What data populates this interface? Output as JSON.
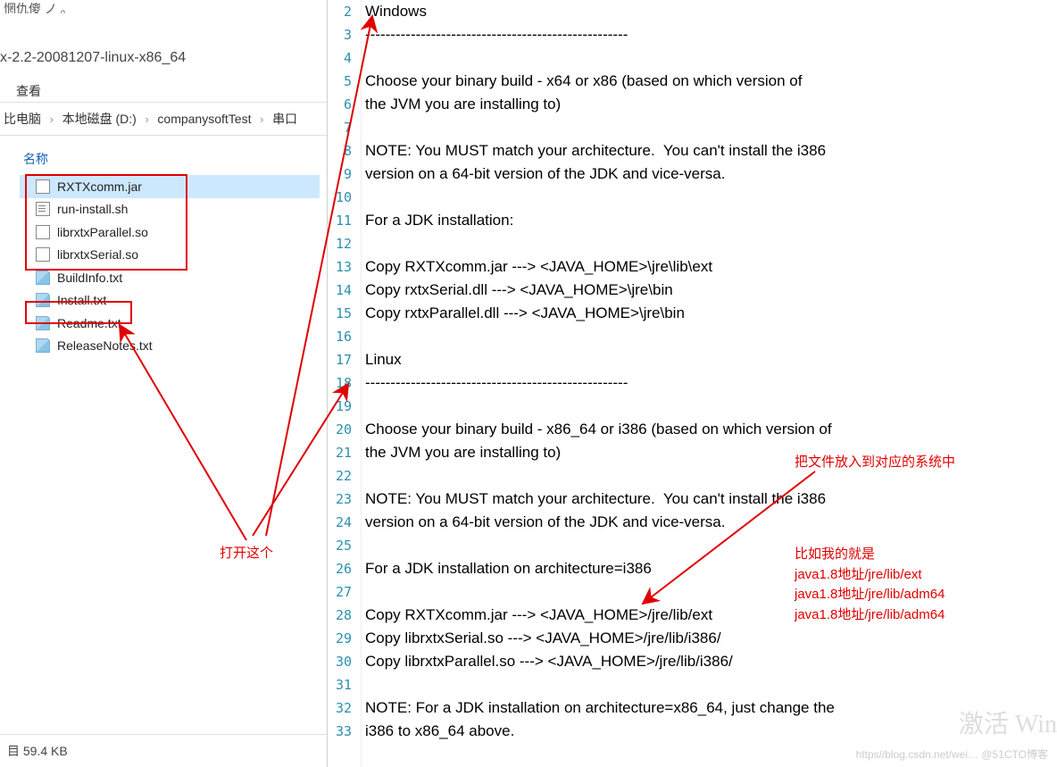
{
  "leftPanel": {
    "truncatedTop": "惘仇傻 ノ  。",
    "windowTitle": "x-2.2-20081207-linux-x86_64",
    "menu": {
      "view": "查看"
    },
    "breadcrumb": {
      "item1": "比电脑",
      "item2": "本地磁盘 (D:)",
      "item3": "companysoftTest",
      "item4": "串口"
    },
    "fileList": {
      "header": "名称",
      "items": [
        {
          "name": "RXTXcomm.jar",
          "icon": "jar",
          "selected": true
        },
        {
          "name": "run-install.sh",
          "icon": "sh",
          "selected": false
        },
        {
          "name": "librxtxParallel.so",
          "icon": "so",
          "selected": false
        },
        {
          "name": "librxtxSerial.so",
          "icon": "so",
          "selected": false
        },
        {
          "name": "BuildInfo.txt",
          "icon": "txt",
          "selected": false
        },
        {
          "name": "Install.txt",
          "icon": "txt",
          "selected": false
        },
        {
          "name": "Readme.txt",
          "icon": "txt",
          "selected": false
        },
        {
          "name": "ReleaseNotes.txt",
          "icon": "txt",
          "selected": false
        }
      ]
    },
    "statusBar": "目 59.4 KB"
  },
  "editor": {
    "startLine": 2,
    "lines": [
      "Windows",
      "----------------------------------------------------",
      "",
      "Choose your binary build - x64 or x86 (based on which version of",
      "the JVM you are installing to)",
      "",
      "NOTE: You MUST match your architecture.  You can't install the i386",
      "version on a 64-bit version of the JDK and vice-versa.",
      "",
      "For a JDK installation:",
      "",
      "Copy RXTXcomm.jar ---> <JAVA_HOME>\\jre\\lib\\ext",
      "Copy rxtxSerial.dll ---> <JAVA_HOME>\\jre\\bin",
      "Copy rxtxParallel.dll ---> <JAVA_HOME>\\jre\\bin",
      "",
      "Linux",
      "----------------------------------------------------",
      "",
      "Choose your binary build - x86_64 or i386 (based on which version of",
      "the JVM you are installing to)",
      "",
      "NOTE: You MUST match your architecture.  You can't install the i386",
      "version on a 64-bit version of the JDK and vice-versa.",
      "",
      "For a JDK installation on architecture=i386",
      "",
      "Copy RXTXcomm.jar ---> <JAVA_HOME>/jre/lib/ext",
      "Copy librxtxSerial.so ---> <JAVA_HOME>/jre/lib/i386/",
      "Copy librxtxParallel.so ---> <JAVA_HOME>/jre/lib/i386/",
      "",
      "NOTE: For a JDK installation on architecture=x86_64, just change the",
      "i386 to x86_64 above."
    ]
  },
  "annotations": {
    "openThis": "打开这个",
    "putFiles": "把文件放入到对应的系统中",
    "example": "比如我的就是\njava1.8地址/jre/lib/ext\njava1.8地址/jre/lib/adm64\njava1.8地址/jre/lib/adm64"
  },
  "watermarks": {
    "csdn": "https//blog.csdn.net/wei…  @51CTO博客",
    "activate": "激活 Win"
  }
}
